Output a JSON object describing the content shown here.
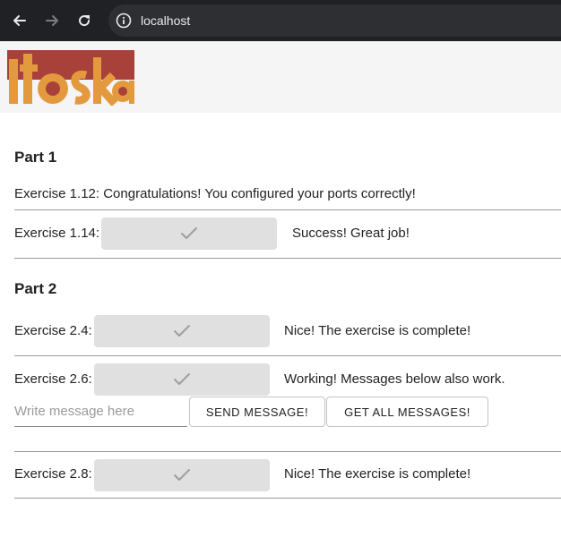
{
  "browser": {
    "url": "localhost",
    "back_icon": "arrow-left-icon",
    "forward_icon": "arrow-right-icon",
    "reload_icon": "reload-icon"
  },
  "colors": {
    "logo_red": "#a8413a",
    "logo_orange": "#e39a3f",
    "button_gray": "#e0e0e0",
    "check_gray": "#9e9e9e"
  },
  "part1": {
    "title": "Part 1",
    "ex112": "Exercise 1.12: Congratulations! You configured your ports correctly!",
    "ex114_label": "Exercise 1.14:",
    "ex114_status": "Success! Great job!"
  },
  "part2": {
    "title": "Part 2",
    "ex24_label": "Exercise 2.4:",
    "ex24_status": "Nice! The exercise is complete!",
    "ex26_label": "Exercise 2.6:",
    "ex26_status": "Working! Messages below also work.",
    "message_placeholder": "Write message here",
    "send_label": "SEND MESSAGE!",
    "get_all_label": "GET ALL MESSAGES!",
    "ex28_label": "Exercise 2.8:",
    "ex28_status": "Nice! The exercise is complete!"
  }
}
